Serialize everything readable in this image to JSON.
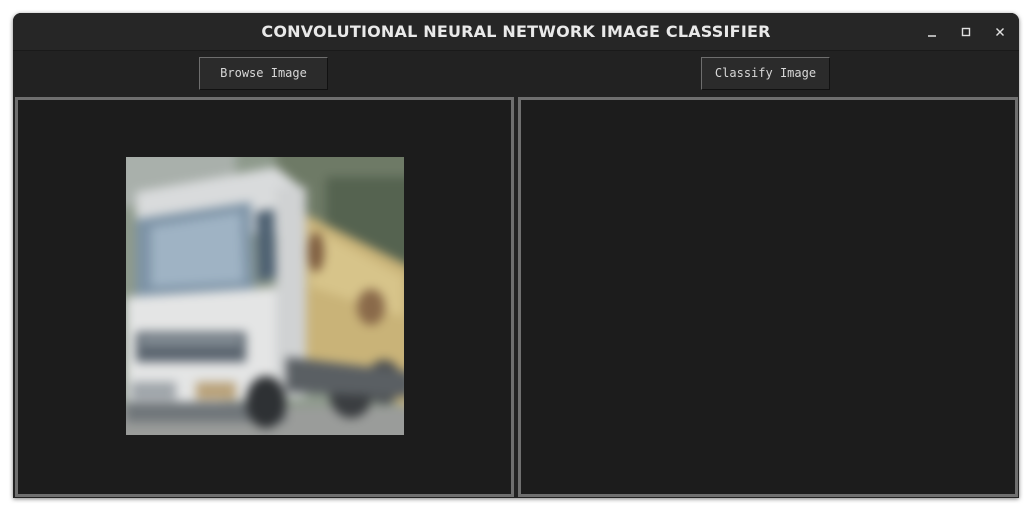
{
  "window": {
    "title": "CONVOLUTIONAL NEURAL NETWORK IMAGE CLASSIFIER",
    "controls": {
      "minimize_icon": "minimize-icon",
      "maximize_icon": "maximize-icon",
      "close_icon": "close-icon"
    }
  },
  "toolbar": {
    "browse_label": "Browse Image",
    "classify_label": "Classify Image"
  },
  "left_panel": {
    "image_subject": "truck"
  },
  "right_panel": {
    "result_text": ""
  },
  "colors": {
    "window_bg": "#222222",
    "panel_bg": "#1c1c1c",
    "panel_border": "#6f6f6f",
    "title_text": "#e9e9e9"
  }
}
